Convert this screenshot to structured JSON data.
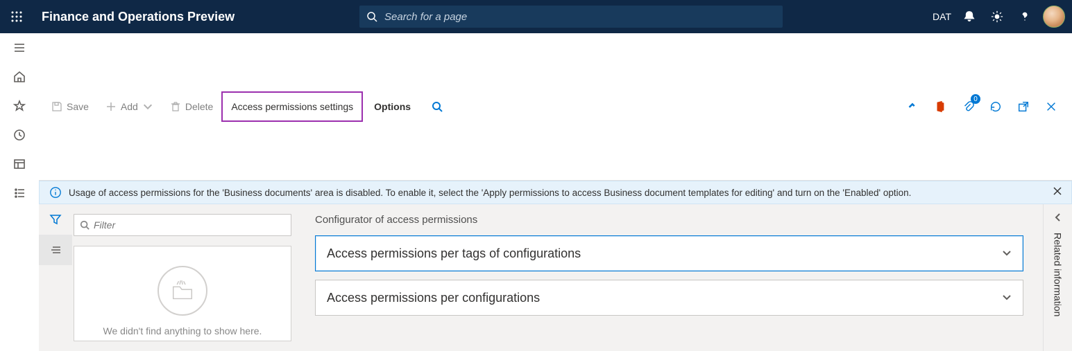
{
  "header": {
    "app_title": "Finance and Operations Preview",
    "search_placeholder": "Search for a page",
    "company_code": "DAT"
  },
  "actionbar": {
    "save": "Save",
    "add": "Add",
    "delete": "Delete",
    "access_permissions_settings": "Access permissions settings",
    "options": "Options",
    "attachment_count": "0"
  },
  "infobar": {
    "message": "Usage of access permissions for the 'Business documents' area is disabled. To enable it, select the 'Apply permissions to access Business document templates for editing' and turn on the 'Enabled' option."
  },
  "list": {
    "filter_placeholder": "Filter",
    "empty_message": "We didn't find anything to show here."
  },
  "detail": {
    "title": "Configurator of access permissions",
    "sections": [
      {
        "label": "Access permissions per tags of configurations"
      },
      {
        "label": "Access permissions per configurations"
      }
    ]
  },
  "right_rail": {
    "label": "Related information"
  }
}
